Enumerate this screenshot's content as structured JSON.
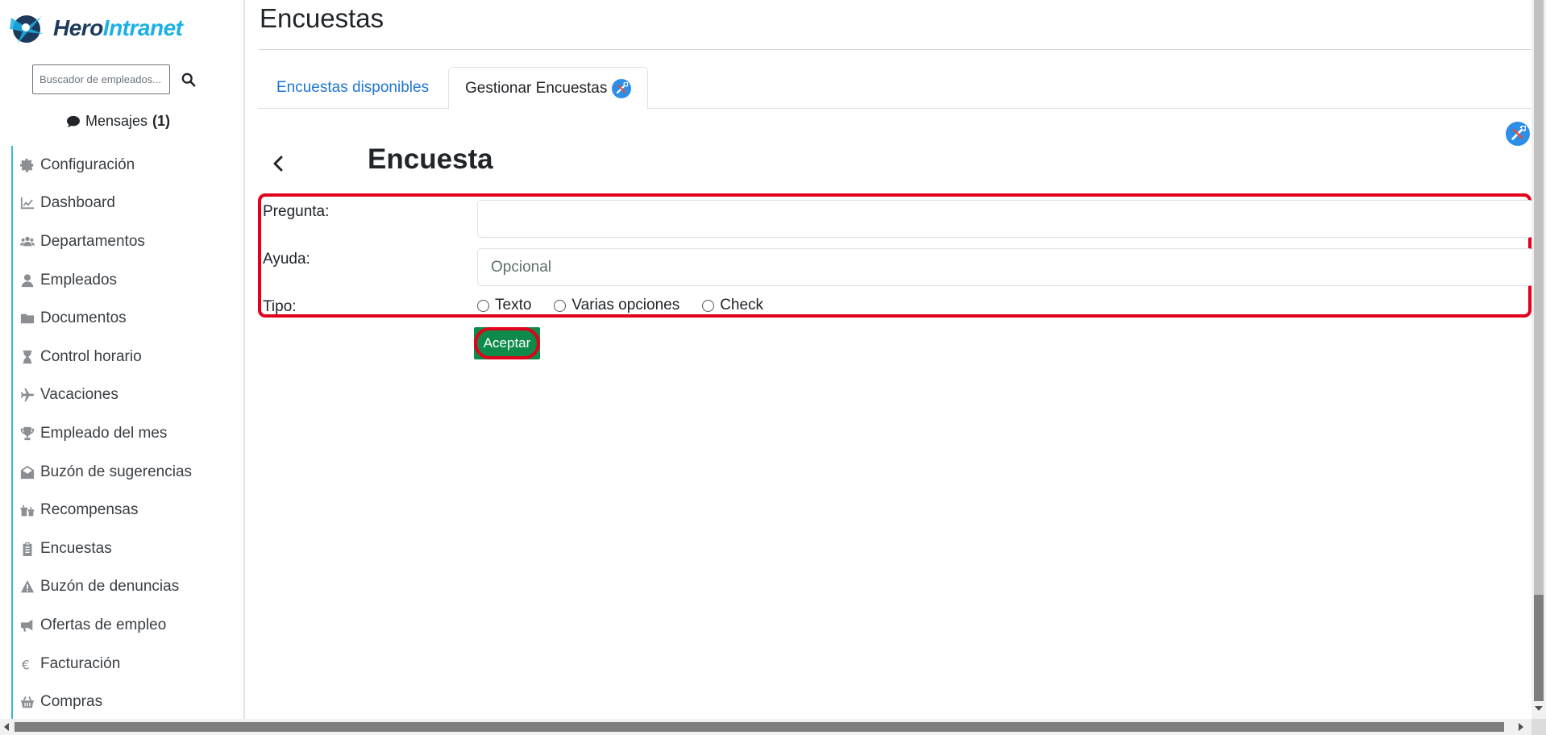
{
  "brand": {
    "name_part1": "Hero",
    "name_part2": "Intranet"
  },
  "sidebar": {
    "search_placeholder": "Buscador de empleados...",
    "messages": {
      "label": "Mensajes",
      "count": "(1)"
    },
    "items": [
      {
        "label": "Configuración",
        "icon": "gear-icon"
      },
      {
        "label": "Dashboard",
        "icon": "chart-line-icon"
      },
      {
        "label": "Departamentos",
        "icon": "users-icon"
      },
      {
        "label": "Empleados",
        "icon": "user-icon"
      },
      {
        "label": "Documentos",
        "icon": "folder-icon"
      },
      {
        "label": "Control horario",
        "icon": "hourglass-icon"
      },
      {
        "label": "Vacaciones",
        "icon": "plane-icon"
      },
      {
        "label": "Empleado del mes",
        "icon": "trophy-icon"
      },
      {
        "label": "Buzón de sugerencias",
        "icon": "envelope-open-icon"
      },
      {
        "label": "Recompensas",
        "icon": "gifts-icon"
      },
      {
        "label": "Encuestas",
        "icon": "clipboard-list-icon"
      },
      {
        "label": "Buzón de denuncias",
        "icon": "warning-icon"
      },
      {
        "label": "Ofertas de empleo",
        "icon": "bullhorn-icon"
      },
      {
        "label": "Facturación",
        "icon": "euro-icon"
      },
      {
        "label": "Compras",
        "icon": "basket-icon"
      }
    ]
  },
  "main": {
    "page_title": "Encuestas",
    "tabs": [
      {
        "label": "Encuestas disponibles",
        "active": false
      },
      {
        "label": "Gestionar Encuestas",
        "active": true
      }
    ],
    "survey_title": "Encuesta",
    "form": {
      "question_label": "Pregunta:",
      "question_value": "",
      "help_label": "Ayuda:",
      "help_placeholder": "Opcional",
      "type_label": "Tipo:",
      "type_options": [
        "Texto",
        "Varias opciones",
        "Check"
      ]
    },
    "accept_label": "Aceptar"
  },
  "colors": {
    "accent_blue": "#1f77d0",
    "nav_border": "#3fb6d6",
    "accept_green": "#0e8a4a",
    "highlight_red": "#e3001b",
    "badge_blue": "#2d8ee8"
  }
}
